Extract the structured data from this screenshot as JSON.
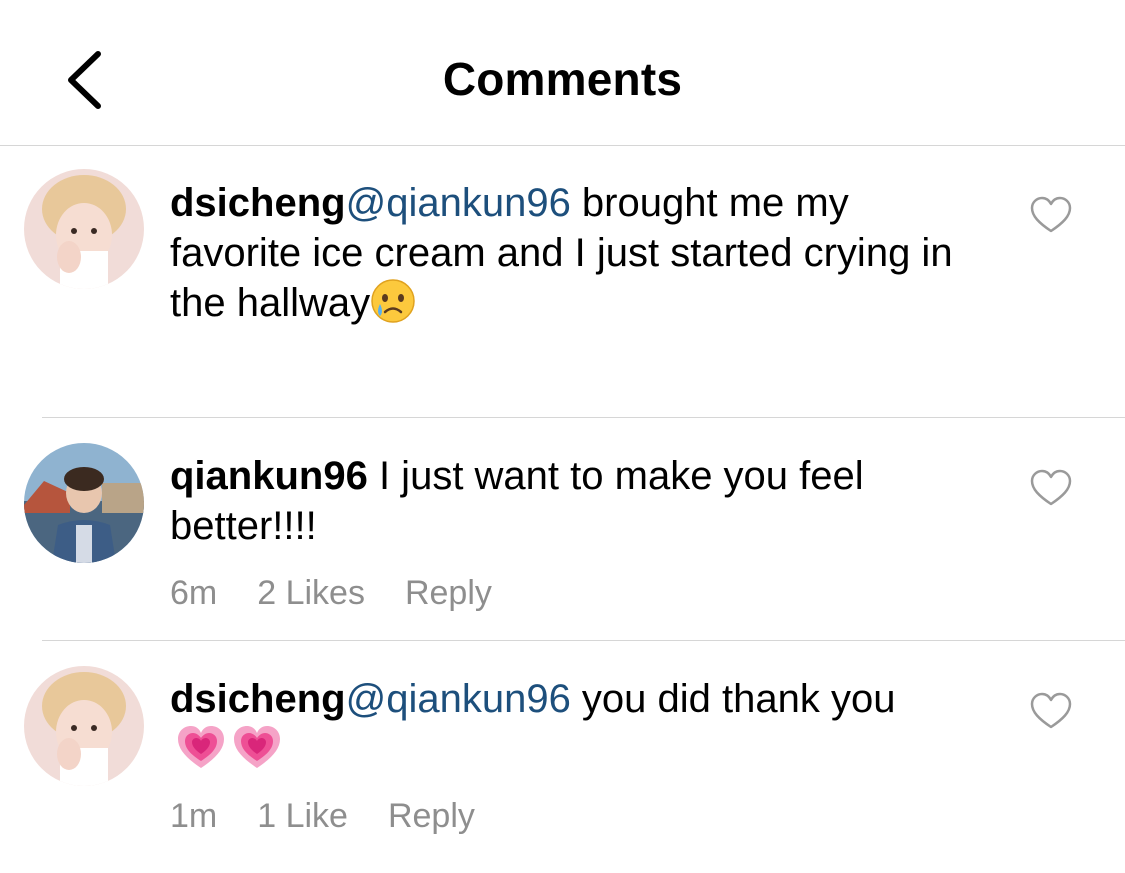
{
  "header": {
    "title": "Comments"
  },
  "comments": [
    {
      "username": "dsicheng",
      "mention": "@qiankun96",
      "text": " brought me my favorite ice cream and I just started crying in the hallway",
      "emoji": "crying-face"
    },
    {
      "username": "qiankun96",
      "text": " I just want to make you feel better!!!!",
      "time": "6m",
      "likes": "2 Likes",
      "reply": "Reply"
    },
    {
      "username": "dsicheng",
      "mention": "@qiankun96",
      "text": " you did thank you",
      "emoji": "growing-heart",
      "time": "1m",
      "likes": "1 Like",
      "reply": "Reply"
    }
  ],
  "colors": {
    "mention": "#1d4f7c",
    "meta": "#8e8e8e",
    "divider": "#d6d6d6"
  }
}
